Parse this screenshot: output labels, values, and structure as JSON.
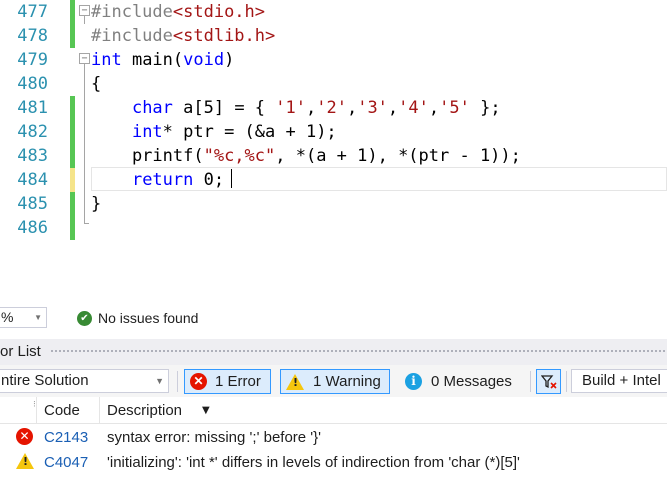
{
  "editor": {
    "lines": [
      {
        "number": "477",
        "text": "#include<stdio.h>"
      },
      {
        "number": "478",
        "text": "#include<stdlib.h>"
      },
      {
        "number": "479",
        "text": "int main(void)"
      },
      {
        "number": "480",
        "text": "{"
      },
      {
        "number": "481",
        "text": "    char a[5] = { '1','2','3','4','5' };"
      },
      {
        "number": "482",
        "text": "    int* ptr = (&a + 1);"
      },
      {
        "number": "483",
        "text": "    printf(\"%c,%c\", *(a + 1), *(ptr - 1));"
      },
      {
        "number": "484",
        "text": "    return 0;"
      },
      {
        "number": "485",
        "text": "}"
      },
      {
        "number": "486",
        "text": ""
      }
    ],
    "colors": {
      "keyword": "#0000ff",
      "string": "#a31515",
      "preprocessor": "#808080",
      "line_number": "#2b91af",
      "saved_change": "#57c654",
      "unsaved_change": "#f5e48a"
    }
  },
  "status": {
    "zoom": "%",
    "issues": "No issues found"
  },
  "error_list": {
    "title": "or List",
    "scope": "ntire Solution",
    "errors_button": "1 Error",
    "warnings_button": "1 Warning",
    "messages_button": "0 Messages",
    "build_filter": "Build + Intel",
    "columns": {
      "code": "Code",
      "description": "Description"
    },
    "rows": [
      {
        "severity": "error",
        "code": "C2143",
        "description": "syntax error: missing ';' before '}'"
      },
      {
        "severity": "warning",
        "code": "C4047",
        "description": "'initializing': 'int *' differs in levels of indirection from 'char (*)[5]'"
      }
    ]
  }
}
